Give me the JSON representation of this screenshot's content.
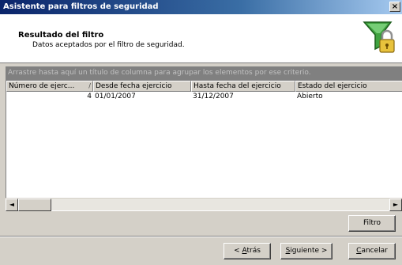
{
  "window": {
    "title": "Asistente para filtros de seguridad",
    "close_label": "×"
  },
  "header": {
    "title": "Resultado del filtro",
    "subtitle": "Datos aceptados por el filtro de seguridad.",
    "icon": "funnel-lock-icon"
  },
  "group_bar": {
    "text": "Arrastre hasta aquí un título de columna para agrupar los elementos por ese criterio."
  },
  "grid": {
    "columns": [
      "Número de ejerc...",
      "Desde fecha ejercicio",
      "Hasta fecha del ejercicio",
      "Estado del ejercicio"
    ],
    "sort_indicator": "/",
    "rows": [
      [
        "4",
        "01/01/2007",
        "31/12/2007",
        "Abierto"
      ]
    ]
  },
  "scrollbar": {
    "left_arrow": "◄",
    "right_arrow": "►"
  },
  "buttons": {
    "filter": "Filtro",
    "back_prefix": "< ",
    "back_hotkey": "A",
    "back_rest": "trás",
    "next_hotkey": "S",
    "next_rest": "iguiente >",
    "cancel_hotkey": "C",
    "cancel_rest": "ancelar"
  },
  "colors": {
    "title_bar": "#0a246a",
    "group_bar": "#808080",
    "face": "#d4d0c8"
  }
}
